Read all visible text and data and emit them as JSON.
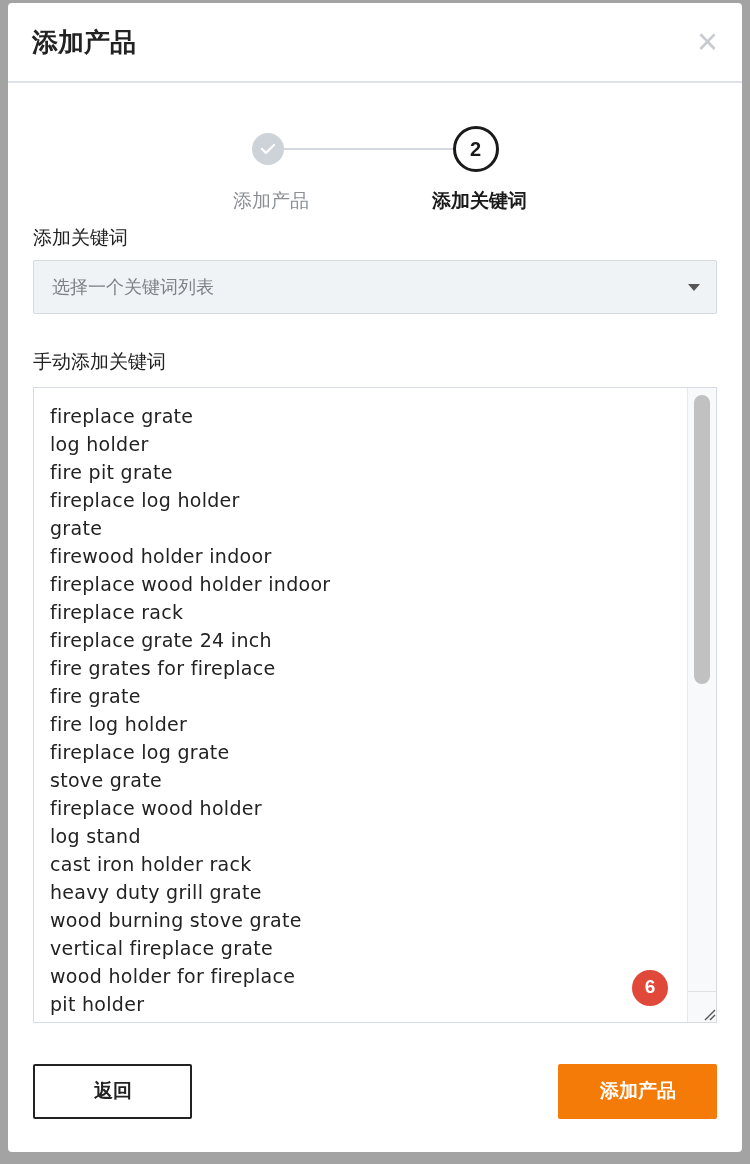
{
  "dialog": {
    "title": "添加产品",
    "close": "×"
  },
  "steps": [
    {
      "label": "添加产品",
      "completed": true
    },
    {
      "label": "添加关键词",
      "completed": false,
      "number": "2"
    }
  ],
  "keyword_list": {
    "label": "添加关键词",
    "placeholder": "选择一个关键词列表"
  },
  "manual_keywords": {
    "label": "手动添加关键词",
    "badge": "6",
    "lines": [
      "fireplace grate",
      "log holder",
      "fire pit grate",
      "fireplace log holder",
      "grate",
      "firewood holder indoor",
      "fireplace wood holder indoor",
      "fireplace rack",
      "fireplace grate 24 inch",
      "fire grates for fireplace",
      "fire grate",
      "fire log holder",
      "fireplace log grate",
      "stove grate",
      "fireplace wood holder",
      "log stand",
      "cast iron holder rack",
      "heavy duty grill grate",
      "wood burning stove grate",
      "vertical fireplace grate",
      "wood holder for fireplace",
      "pit holder"
    ]
  },
  "buttons": [
    {
      "label": "返回",
      "kind": "secondary"
    },
    {
      "label": "添加产品",
      "kind": "primary"
    }
  ]
}
